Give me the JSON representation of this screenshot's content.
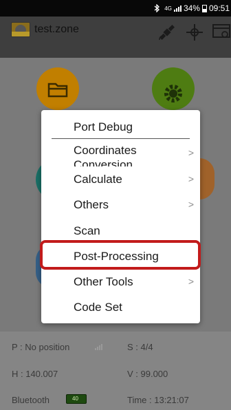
{
  "status_bar": {
    "bluetooth_icon": "bluetooth-icon",
    "signal_label": "4G",
    "battery_text": "34%",
    "time": "09:51"
  },
  "app_bar": {
    "title": "test.zone",
    "icons": [
      "satellite-icon",
      "crosshair-icon",
      "monitor-settings-icon"
    ]
  },
  "main": {
    "icons": [
      "folder-icon",
      "gear-icon",
      "teal-icon",
      "orange-icon",
      "blue-icon"
    ],
    "colors": {
      "folder": "#d08a00",
      "gear": "#5a8c18",
      "teal": "#1c7f74",
      "orange": "#b2702e",
      "blue": "#3c6a93"
    }
  },
  "status_panel": {
    "position": "P : No position",
    "satellites": "S : 4/4",
    "h_value": "H : 140.007",
    "v_value": "V : 99.000",
    "connection": "Bluetooth",
    "battery_level": "40",
    "time": "Time :  13:21:07"
  },
  "menu": {
    "items": [
      {
        "label": "Port Debug",
        "has_submenu": false
      },
      {
        "label": "Coordinates Conversion",
        "has_submenu": true
      },
      {
        "label": "Calculate",
        "has_submenu": true
      },
      {
        "label": "Others",
        "has_submenu": true
      },
      {
        "label": "Scan",
        "has_submenu": false
      },
      {
        "label": "Post-Processing",
        "has_submenu": false
      },
      {
        "label": "Other Tools",
        "has_submenu": true
      },
      {
        "label": "Code Set",
        "has_submenu": false
      }
    ],
    "highlight_color": "#c21b1b"
  }
}
